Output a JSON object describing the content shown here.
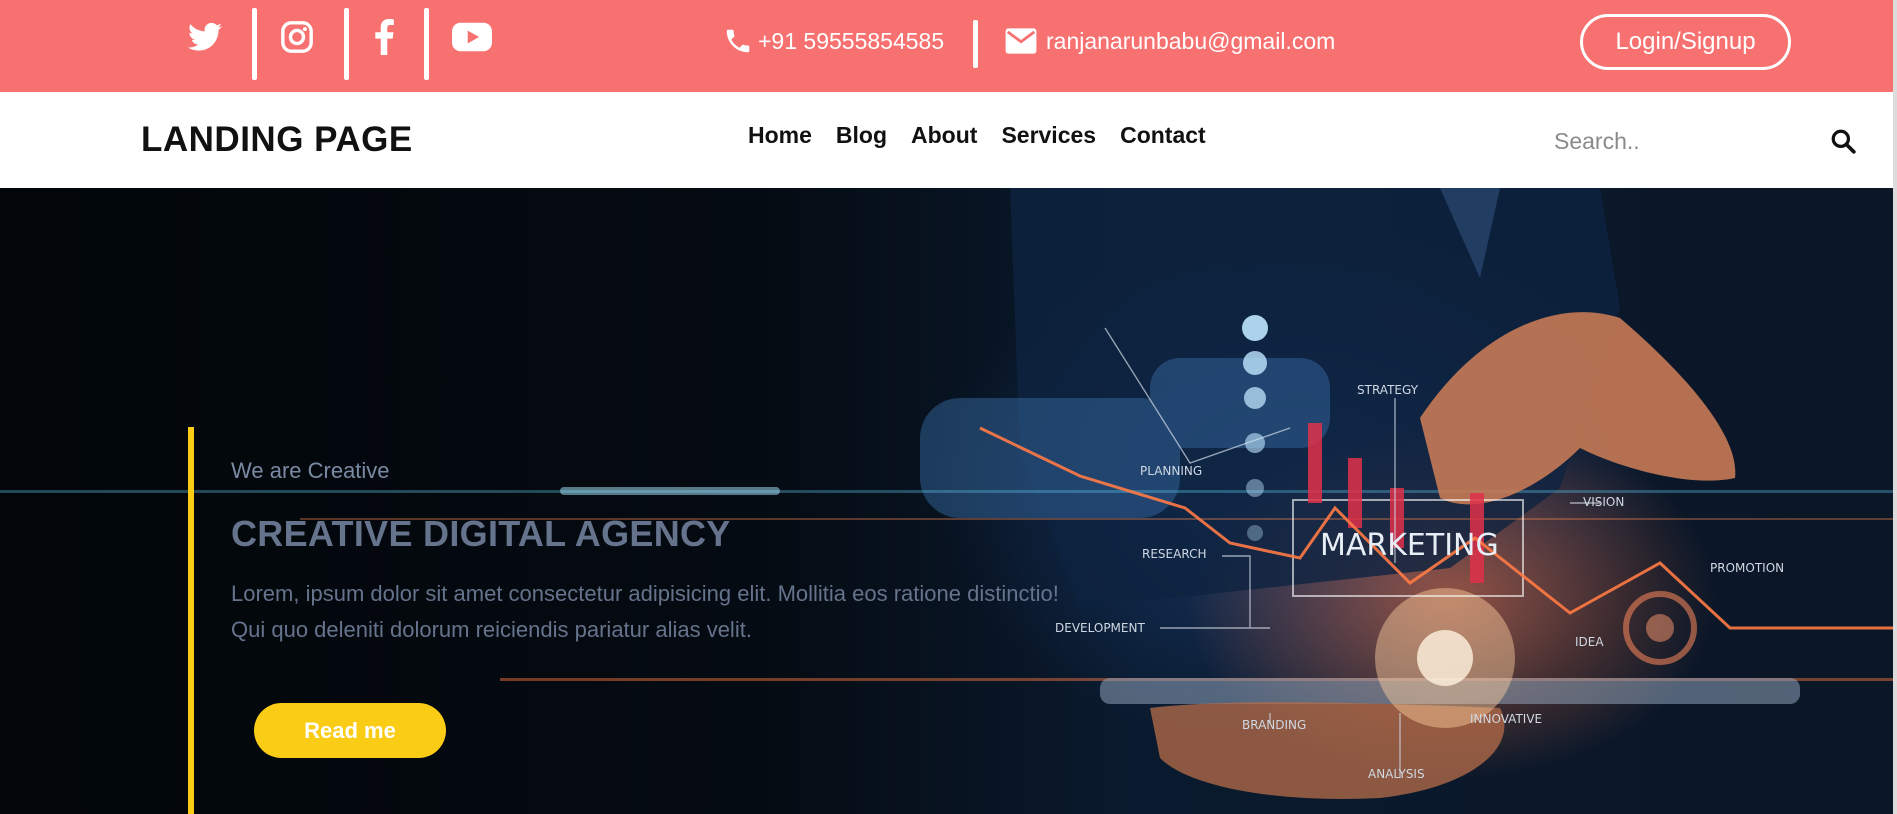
{
  "topbar": {
    "social": [
      {
        "icon": "twitter-icon"
      },
      {
        "icon": "instagram-icon"
      },
      {
        "icon": "facebook-icon"
      },
      {
        "icon": "youtube-icon"
      }
    ],
    "phone": "+91 59555854585",
    "email": "ranjanarunbabu@gmail.com",
    "login_label": "Login/Signup"
  },
  "navbar": {
    "brand": "LANDING PAGE",
    "links": [
      "Home",
      "Blog",
      "About",
      "Services",
      "Contact"
    ],
    "search_placeholder": "Search.."
  },
  "hero": {
    "tagline": "We are Creative",
    "title": "CREATIVE DIGITAL AGENCY",
    "text": "Lorem, ipsum dolor sit amet consectetur adipisicing elit. Mollitia eos ratione distinctio! Qui quo deleniti dolorum reiciendis pariatur alias velit.",
    "button_label": "Read me",
    "image_labels": [
      "STRATEGY",
      "PLANNING",
      "RESEARCH",
      "DEVELOPMENT",
      "MARKETING",
      "VISION",
      "PROMOTION",
      "IDEA",
      "BRANDING",
      "INNOVATIVE",
      "ANALYSIS"
    ]
  },
  "colors": {
    "topbar_bg": "#f87171",
    "accent_yellow": "#facc15",
    "hero_text": "#66738c"
  }
}
